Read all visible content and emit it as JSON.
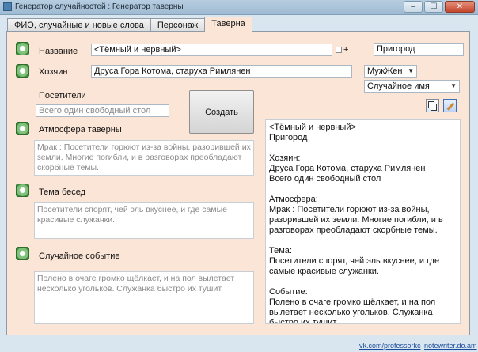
{
  "window": {
    "title": "Генератор случайностей : Генератор таверны",
    "min_glyph": "–",
    "max_glyph": "☐",
    "close_glyph": "✕"
  },
  "tabs": [
    {
      "label": "ФИО, случайные и новые слова"
    },
    {
      "label": "Персонаж"
    },
    {
      "label": "Таверна",
      "active": true
    }
  ],
  "form": {
    "name": {
      "label": "Название",
      "value": "<Тёмный и нервный>",
      "plus": "+"
    },
    "location": {
      "value": "Пригород"
    },
    "owner": {
      "label": "Хозяин",
      "value": "Друса Гора Котома, старуха Римлянен"
    },
    "gender": {
      "value": "МужЖен"
    },
    "random_name": {
      "value": "Случайное имя"
    },
    "visitors": {
      "label": "Посетители",
      "placeholder": "Всего один свободный стол"
    },
    "create_label": "Создать",
    "atmosphere": {
      "label": "Атмосфера таверны",
      "placeholder": "Мрак : Посетители горюют из-за войны, разорившей их земли. Многие погибли, и в разговорах преобладают скорбные темы."
    },
    "talk": {
      "label": "Тема бесед",
      "placeholder": "Посетители спорят, чей эль вкуснее, и где самые красивые служанки."
    },
    "event": {
      "label": "Случайное событие",
      "placeholder": "Полено в очаге громко щёлкает, и на пол вылетает несколько угольков. Служанка быстро их тушит."
    }
  },
  "output_text": "<Тёмный и нервный>\nПригород\n\nХозяин:\nДруса Гора Котома, старуха Римлянен\nВсего один свободный стол\n\nАтмосфера:\nМрак : Посетители горюют из-за войны, разорившей их земли. Многие погибли, и в разговорах преобладают скорбные темы.\n\nТема:\nПосетители спорят, чей эль вкуснее, и где самые красивые служанки.\n\nСобытие:\nПолено в очаге громко щёлкает, и на пол вылетает несколько угольков. Служанка быстро их тушит.",
  "footer": {
    "link1": "vk.com/professorkc",
    "link2": "notewriter.do.am"
  },
  "colors": {
    "panel_bg": "#fbe5d6",
    "check_green": "#3d8a3a",
    "link": "#1a4a9c"
  },
  "icons": [
    "copy-icon",
    "edit-icon"
  ]
}
